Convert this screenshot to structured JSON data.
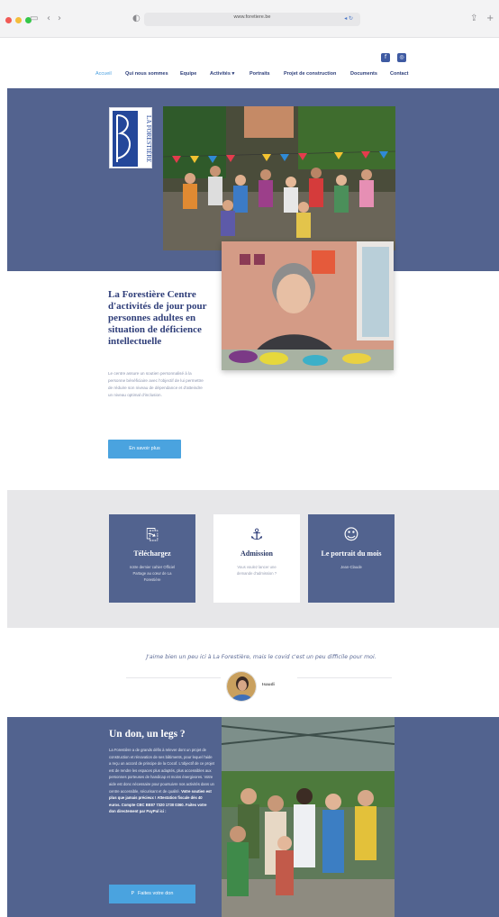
{
  "browser": {
    "url": "www.foretiere.be",
    "traffic_light_colors": [
      "#f15a55",
      "#f4bd3b",
      "#34c748"
    ]
  },
  "header": {
    "social": [
      {
        "name": "facebook",
        "glyph": "f"
      },
      {
        "name": "instagram",
        "glyph": "◎"
      }
    ],
    "nav": [
      {
        "label": "Accueil",
        "active": true
      },
      {
        "label": "Qui nous sommes",
        "active": false
      },
      {
        "label": "Equipe",
        "active": false
      },
      {
        "label": "Activités ▾",
        "active": false
      },
      {
        "label": "Portraits",
        "active": false
      },
      {
        "label": "Projet de construction",
        "active": false
      },
      {
        "label": "Documents",
        "active": false
      },
      {
        "label": "Contact",
        "active": false
      }
    ]
  },
  "hero": {
    "logo_text": "LA FORESTIÈRE",
    "title": "La Forestière Centre d'activités de jour pour personnes adultes en situation de déficience intellectuelle",
    "text": "Le centre assure un soutien personnalisé à la personne bénéficiaire avec l'objectif de lui permettre de réduire son niveau de dépendance et d'atteindre un niveau optimal d'inclusion.",
    "button": "En savoir plus"
  },
  "cards": [
    {
      "icon": "pdf-icon",
      "glyph": "⎘",
      "title": "Téléchargez",
      "text": "notre dernier cahier Officiel Partage au cœur de La Forestière",
      "style": "blue"
    },
    {
      "icon": "anchor-icon",
      "glyph": "⚓",
      "title": "Admission",
      "text": "Vous voulez lancer une demande d'admission ?",
      "style": "white"
    },
    {
      "icon": "smile-icon",
      "glyph": "☺",
      "title": "Le portrait du mois",
      "text": "Jean-Claude",
      "style": "blue"
    }
  ],
  "testimonial": {
    "quote": "J'aime bien un peu ici à La Forestière, mais le covid c'est un peu difficile pour moi.",
    "author": "Isaudi"
  },
  "donation": {
    "title": "Un don, un legs ?",
    "text": "La Forestière a de grands défis à relever dont un projet de construction et rénovation de ses bâtiments, pour lequel l'aide a reçu un accord de principe de la Cocof. L'objectif de ce projet est de rendre les espaces plus adaptés, plus accessibles aux personnes porteuses de handicap et moins énergivores. Votre aide est donc nécessaire pour poursuivre nos activités dans un centre accessible, sécurisant et de qualité.",
    "bold_text": "Votre soutien est plus que jamais précieux ! Attestation fiscale dès 40 euros. Compte CBC BE87 7320 1730 0360. Faites votre don directement par PayPal ici :",
    "button": "Faites votre don"
  }
}
